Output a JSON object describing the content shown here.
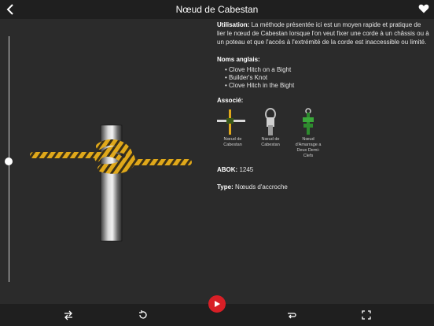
{
  "header": {
    "title": "Nœud de Cabestan"
  },
  "info": {
    "usage_label": "Utilisation:",
    "usage_text": " La méthode présentée ici est un moyen rapide et pratique de lier le nœud de Cabestan lorsque l'on veut fixer une corde à un châssis ou à un poteau et que l'accès à l'extrémité de la corde est inaccessible ou limité.",
    "english_names_title": "Noms anglais:",
    "english_names": [
      "Clove Hitch on a Bight",
      "Builder's Knot",
      "Clove Hitch in the Bight"
    ],
    "related_title": "Associé:",
    "related": [
      {
        "label": "Nœud de Cabestan"
      },
      {
        "label": "Nœud de Cabestan"
      },
      {
        "label": "Nœud d'Amarrage a Deux Demi-Clefs"
      }
    ],
    "abok_label": "ABOK:",
    "abok_value": " 1245",
    "type_label": "Type:",
    "type_value": " Nœuds d'accroche"
  },
  "viewer": {
    "progress": 0.0
  },
  "icons": {
    "back": "chevron-left-icon",
    "favorite": "heart-icon",
    "flip": "swap-arrows-icon",
    "rotate": "rotate-icon",
    "play": "play-icon",
    "loop": "loop-icon",
    "fullscreen": "fullscreen-icon"
  },
  "colors": {
    "accent": "#d81f26",
    "rope_primary": "#e0a81a",
    "rope_secondary": "#2a2a2a",
    "pole": "#9a9a9a"
  }
}
